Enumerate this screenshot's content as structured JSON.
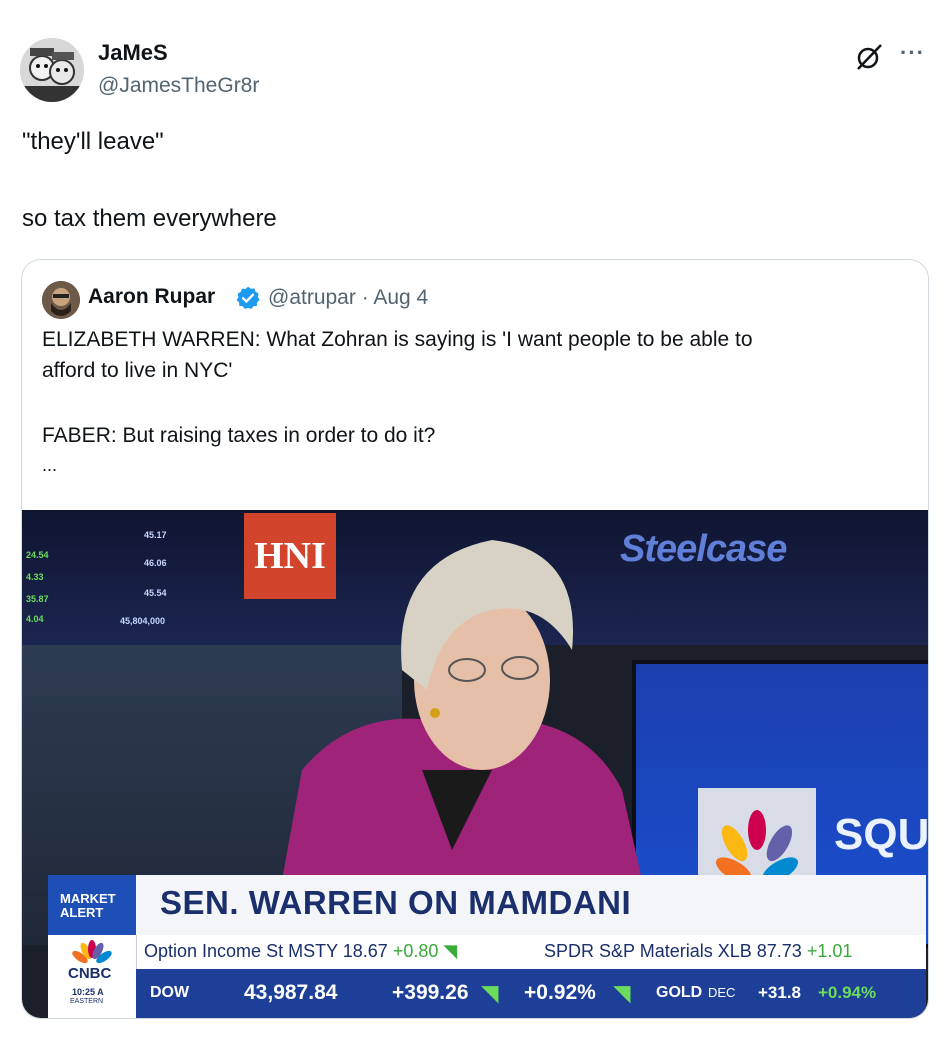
{
  "author": {
    "name": "JaMeS",
    "handle": "@JamesTheGr8r"
  },
  "tweet": {
    "line1": "\"they'll leave\"",
    "line2": "so tax them everywhere"
  },
  "quoted": {
    "name": "Aaron Rupar",
    "handle_date": "@atrupar · Aug 4",
    "line1": "ELIZABETH WARREN: What Zohran is saying is 'I want people to be able to",
    "line2": "afford to live in NYC'",
    "line3": "FABER: But raising taxes in order to do it?",
    "ellipsis": "..."
  },
  "media": {
    "board_hni": "HNI",
    "board_steelcase": "Steelcase",
    "screen_text": "SQU",
    "board_values_left": [
      "45.17",
      "46.06",
      "45.54",
      "45,804,000"
    ],
    "board_values_far_left": [
      "24.54",
      "4.33",
      "35.87",
      "4.04"
    ],
    "lower_third": {
      "market_alert_1": "MARKET",
      "market_alert_2": "ALERT",
      "headline": "SEN. WARREN ON MAMDANI",
      "ticker1_label": "Option Income St MSTY 18.67",
      "ticker1_change": "+0.80",
      "ticker2_label": "SPDR S&P Materials XLB 87.73",
      "ticker2_change": "+1.01",
      "network": "CNBC",
      "time": "10:25 A",
      "timezone": "EASTERN",
      "dow_label": "DOW",
      "dow_value": "43,987.84",
      "dow_change": "+399.26",
      "dow_pct": "+0.92%",
      "gold_label": "GOLD",
      "gold_month": "DEC",
      "gold_change": "+31.8",
      "gold_pct": "+0.94%"
    }
  },
  "colors": {
    "accent_blue": "#1d9bf0",
    "handle_gray": "#536471",
    "border": "#cfd9de"
  },
  "icons": [
    "grok-icon",
    "more-icon",
    "verified-badge-icon"
  ]
}
